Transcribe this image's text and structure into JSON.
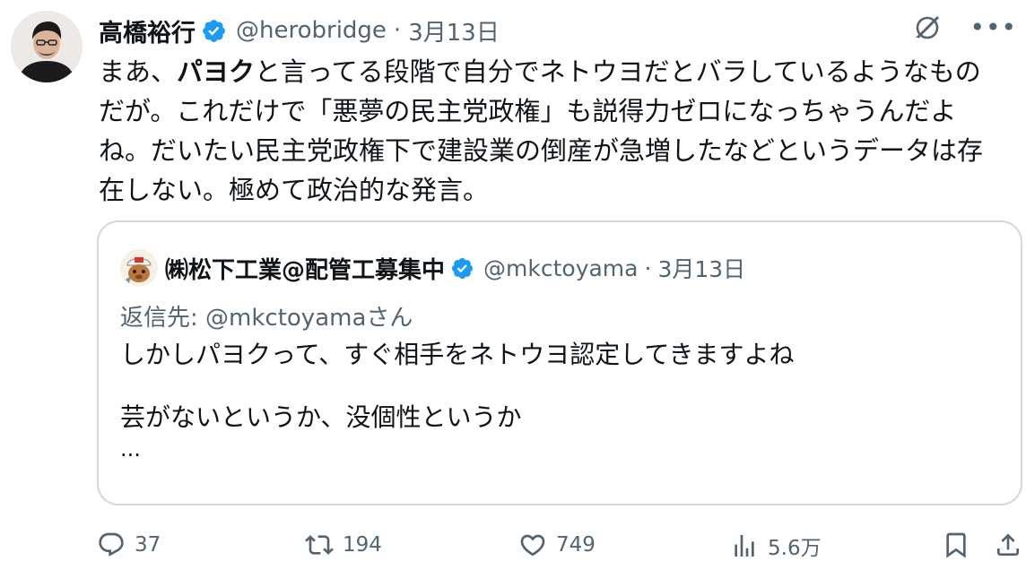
{
  "tweet": {
    "author_name": "高橋裕行",
    "handle": "@herobridge",
    "separator": "·",
    "date": "3月13日",
    "text_prefix": "まあ、",
    "text_bold": "パヨク",
    "text_rest": "と言ってる段階で自分でネトウヨだとバラしているようなものだが。これだけで「悪夢の民主党政権」も説得力ゼロになっちゃうんだよね。だいたい民主党政権下で建設業の倒産が急増したなどというデータは存在しない。極めて政治的な発言。"
  },
  "quoted_tweet": {
    "author_name": "㈱松下工業@配管工募集中",
    "handle": "@mkctoyama",
    "separator": "·",
    "date": "3月13日",
    "reply_to": "返信先: @mkctoyamaさん",
    "body_line1": "しかしパヨクって、すぐ相手をネトウヨ認定してきますよね",
    "body_line2": "芸がないというか、没個性というか",
    "ellipsis": "..."
  },
  "actions": {
    "replies": "37",
    "reposts": "194",
    "likes": "749",
    "views": "5.6万"
  },
  "colors": {
    "text": "#0f1419",
    "secondary": "#536471",
    "verified_blue": "#1d9bf0",
    "border": "#cfd9de"
  },
  "icons": [
    "verified-badge-icon",
    "grok-icon",
    "more-icon",
    "reply-icon",
    "repost-icon",
    "like-icon",
    "views-icon",
    "bookmark-icon",
    "share-icon"
  ]
}
